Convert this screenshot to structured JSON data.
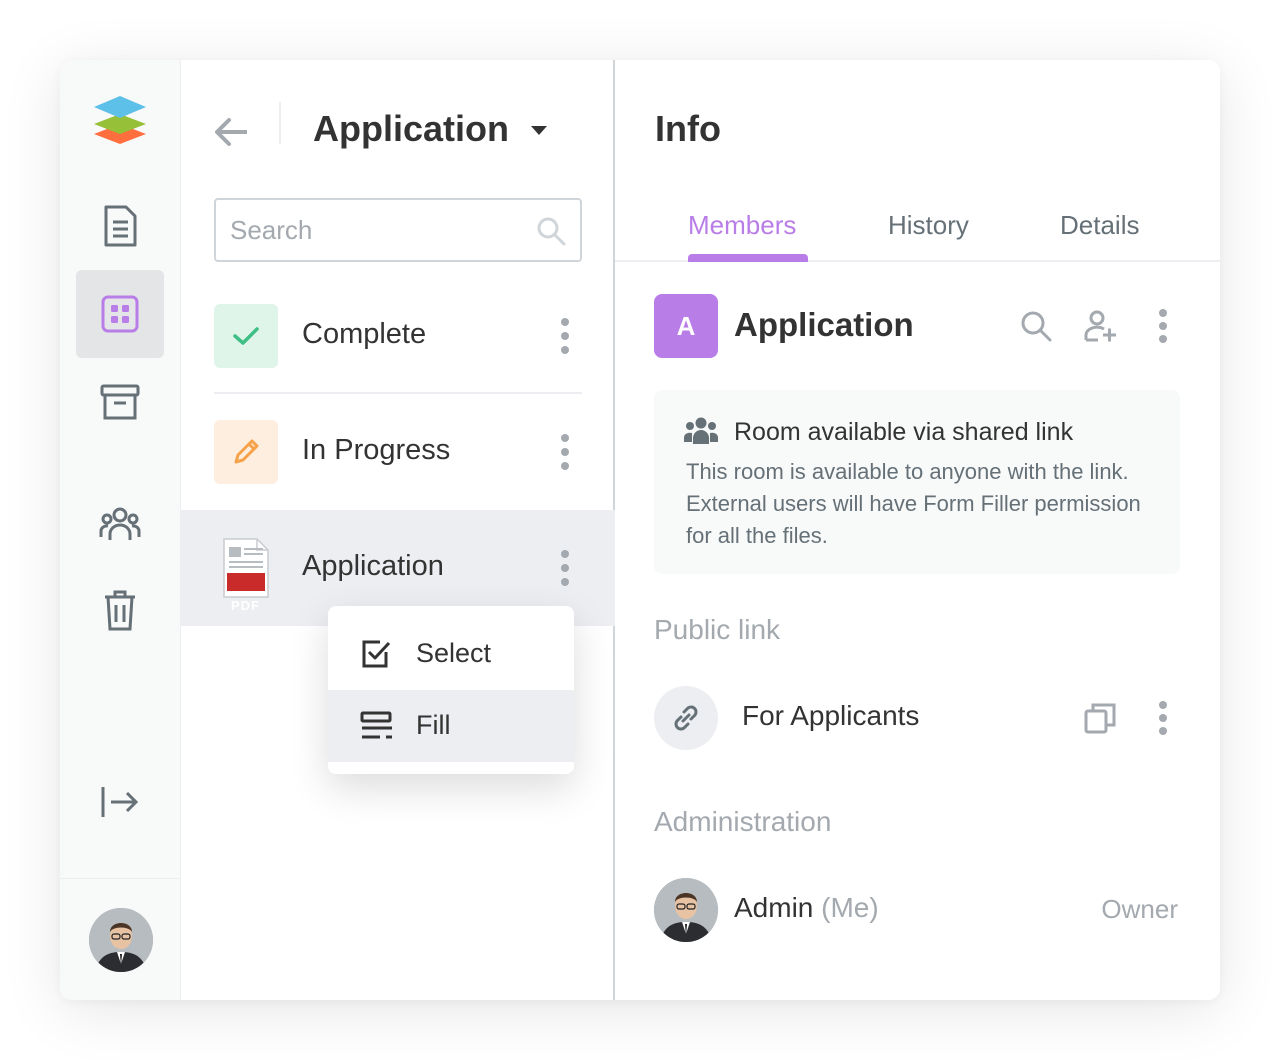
{
  "sidebar": {
    "items": [
      {
        "icon": "document-icon",
        "active": false
      },
      {
        "icon": "rooms-grid-icon",
        "active": true
      },
      {
        "icon": "archive-icon",
        "active": false
      },
      {
        "icon": "people-icon",
        "active": false
      },
      {
        "icon": "trash-icon",
        "active": false
      }
    ],
    "accent": "#b97de8"
  },
  "folder": {
    "title": "Application",
    "search_placeholder": "Search",
    "items": [
      {
        "label": "Complete",
        "icon": "checkmark-icon",
        "color": "#3fbf86"
      },
      {
        "label": "In Progress",
        "icon": "pencil-icon",
        "color": "#f5a24a"
      },
      {
        "label": "Application",
        "icon": "pdf-file-icon",
        "badge": "PDF"
      }
    ]
  },
  "context_menu": {
    "items": [
      {
        "label": "Select",
        "icon": "select-checkbox-icon"
      },
      {
        "label": "Fill",
        "icon": "fill-form-icon"
      }
    ]
  },
  "info": {
    "title": "Info",
    "tabs": [
      "Members",
      "History",
      "Details"
    ],
    "active_tab": "Members",
    "room": {
      "initial": "A",
      "name": "Application"
    },
    "notice": {
      "title": "Room available via shared link",
      "description": "This room is available to anyone with the link. External users will have Form Filler permission for all the files."
    },
    "public_link_label": "Public link",
    "public_link_name": "For Applicants",
    "administration_label": "Administration",
    "admin": {
      "name": "Admin",
      "me": "(Me)",
      "role": "Owner"
    }
  }
}
